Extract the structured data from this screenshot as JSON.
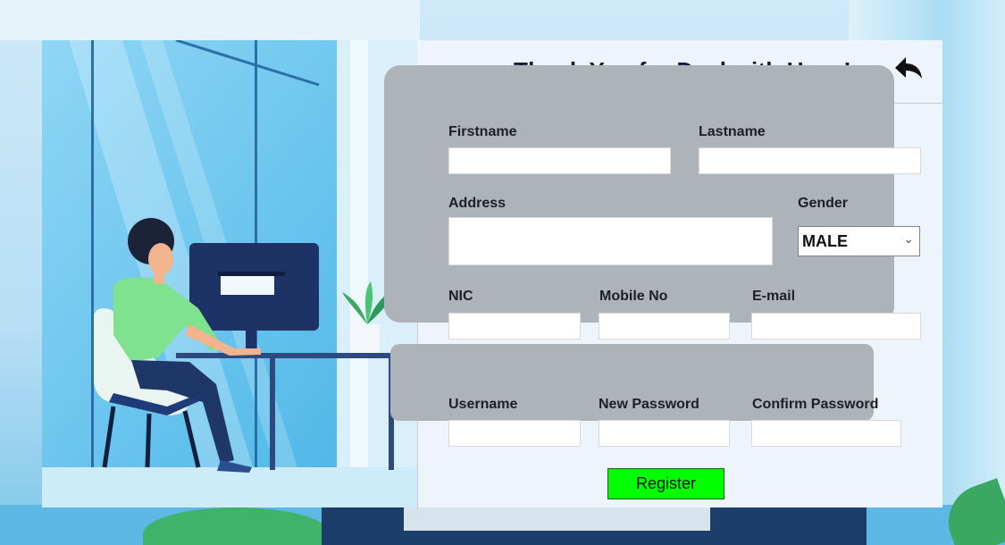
{
  "header": {
    "title": "Thank You for Deal with Us....!",
    "back_icon": "back-arrow-icon"
  },
  "form": {
    "firstname_label": "Firstname",
    "lastname_label": "Lastname",
    "address_label": "Address",
    "gender_label": "Gender",
    "gender_value": "MALE",
    "nic_label": "NIC",
    "mobile_label": "Mobile No",
    "email_label": "E-mail",
    "username_label": "Username",
    "new_password_label": "New Password",
    "confirm_password_label": "Confirm Password",
    "register_label": "Register"
  },
  "colors": {
    "panel": "#aeb3b9",
    "register_button": "#00ff00",
    "title": "#151a3f"
  }
}
